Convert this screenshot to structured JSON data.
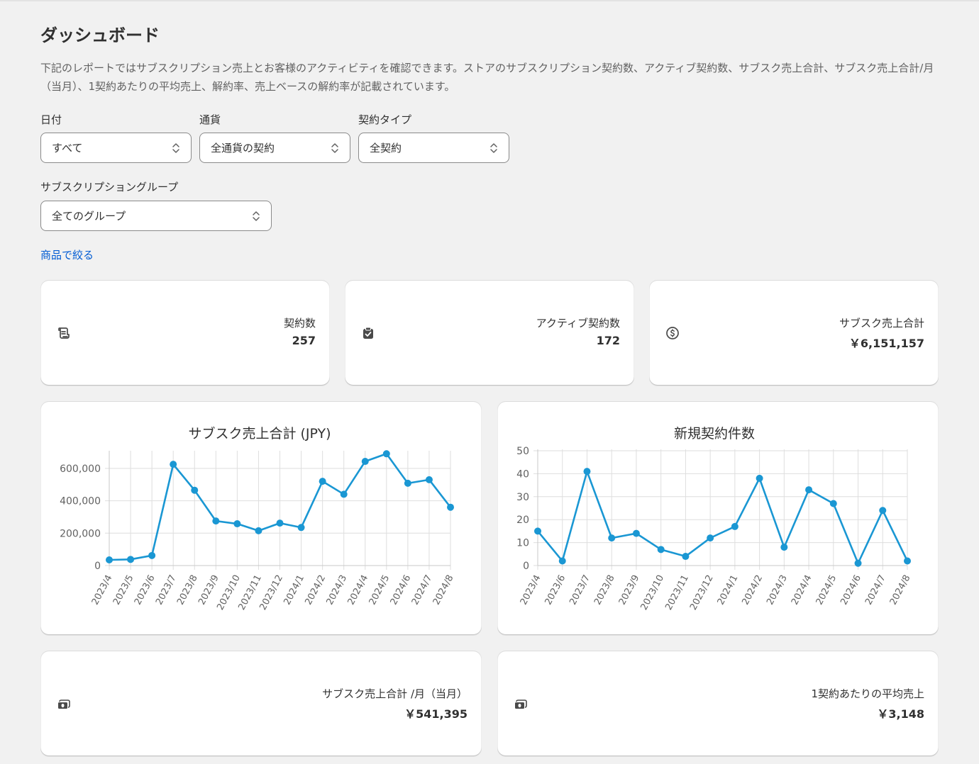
{
  "page": {
    "title": "ダッシュボード",
    "description": "下記のレポートではサブスクリプション売上とお客様のアクティビティを確認できます。ストアのサブスクリプション契約数、アクティブ契約数、サブスク売上合計、サブスク売上合計/月（当月）、1契約あたりの平均売上、解約率、売上ベースの解約率が記載されています。"
  },
  "filters": {
    "date": {
      "label": "日付",
      "value": "すべて"
    },
    "currency": {
      "label": "通貨",
      "value": "全通貨の契約"
    },
    "contract_type": {
      "label": "契約タイプ",
      "value": "全契約"
    },
    "group": {
      "label": "サブスクリプショングループ",
      "value": "全てのグループ"
    },
    "product_filter_link": "商品で絞る"
  },
  "stats": {
    "contracts": {
      "label": "契約数",
      "value": "257",
      "icon": "receipt-icon"
    },
    "active_contracts": {
      "label": "アクティブ契約数",
      "value": "172",
      "icon": "clipboard-check-icon"
    },
    "total_revenue": {
      "label": "サブスク売上合計",
      "value": "￥6,151,157",
      "icon": "dollar-circle-icon"
    },
    "monthly_revenue": {
      "label": "サブスク売上合計 /月（当月）",
      "value": "￥541,395",
      "icon": "cash-icon"
    },
    "avg_revenue": {
      "label": "1契約あたりの平均売上",
      "value": "￥3,148",
      "icon": "cash-icon"
    }
  },
  "colors": {
    "series": "#1a97d3",
    "link": "#005bd3"
  },
  "chart_data": [
    {
      "type": "line",
      "title": "サブスク売上合計 (JPY)",
      "categories": [
        "2023/4",
        "2023/5",
        "2023/6",
        "2023/7",
        "2023/8",
        "2023/9",
        "2023/10",
        "2023/11",
        "2023/12",
        "2024/1",
        "2024/2",
        "2024/3",
        "2024/4",
        "2024/5",
        "2024/6",
        "2024/7",
        "2024/8"
      ],
      "values": [
        35000,
        38000,
        62000,
        625000,
        465000,
        275000,
        258000,
        215000,
        262000,
        235000,
        520000,
        440000,
        643000,
        690000,
        508000,
        530000,
        360000
      ],
      "ylim": [
        0,
        700000
      ],
      "yticks": [
        "0",
        "200,000",
        "400,000",
        "600,000"
      ],
      "ytick_values": [
        0,
        200000,
        400000,
        600000
      ],
      "grid": true
    },
    {
      "type": "line",
      "title": "新規契約件数",
      "categories": [
        "2023/4",
        "2023/6",
        "2023/7",
        "2023/8",
        "2023/9",
        "2023/10",
        "2023/11",
        "2023/12",
        "2024/1",
        "2024/2",
        "2024/3",
        "2024/4",
        "2024/5",
        "2024/6",
        "2024/7",
        "2024/8"
      ],
      "values": [
        15,
        2,
        41,
        12,
        14,
        7,
        4,
        12,
        17,
        38,
        8,
        33,
        27,
        1,
        24,
        2
      ],
      "ylim": [
        0,
        50
      ],
      "yticks": [
        "0",
        "10",
        "20",
        "30",
        "40",
        "50"
      ],
      "ytick_values": [
        0,
        10,
        20,
        30,
        40,
        50
      ],
      "grid": true
    }
  ]
}
